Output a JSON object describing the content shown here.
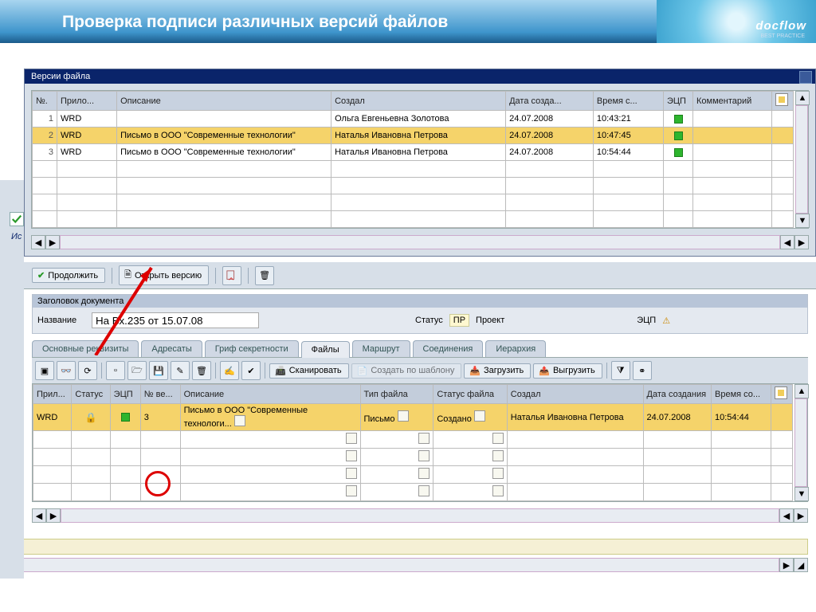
{
  "banner": {
    "title": "Проверка подписи различных версий файлов",
    "logo": "docflow",
    "logo_sub": "BEST PRACTICE"
  },
  "side": {
    "is": "Ис"
  },
  "versions": {
    "title": "Версии файла",
    "cols": [
      "№.",
      "Прило...",
      "Описание",
      "Создал",
      "Дата созда...",
      "Время с...",
      "ЭЦП",
      "Комментарий"
    ],
    "rows": [
      {
        "n": "1",
        "app": "WRD",
        "desc": "",
        "by": "Ольга Евгеньевна Золотова",
        "date": "24.07.2008",
        "time": "10:43:21",
        "ecp": true,
        "cmt": ""
      },
      {
        "n": "2",
        "app": "WRD",
        "desc": "Письмо в ООО \"Современные технологии\"",
        "by": "Наталья Ивановна Петрова",
        "date": "24.07.2008",
        "time": "10:47:45",
        "ecp": true,
        "cmt": ""
      },
      {
        "n": "3",
        "app": "WRD",
        "desc": "Письмо в ООО \"Современные технологии\"",
        "by": "Наталья Ивановна Петрова",
        "date": "24.07.2008",
        "time": "10:54:44",
        "ecp": true,
        "cmt": ""
      }
    ],
    "highlight": 1
  },
  "toolbar": {
    "cont": "Продолжить",
    "open": "Открыть версию"
  },
  "header": {
    "box": "Заголовок документа",
    "name_lbl": "Название",
    "name_val": "На Вх.235 от 15.07.08",
    "status_lbl": "Статус",
    "status_tag": "ПР",
    "status_val": "Проект",
    "ecp_lbl": "ЭЦП"
  },
  "tabs": [
    "Основные реквизиты",
    "Адресаты",
    "Гриф секретности",
    "Файлы",
    "Маршрут",
    "Соединения",
    "Иерархия"
  ],
  "tabs_active": 3,
  "file_toolbar": {
    "scan": "Сканировать",
    "tpl": "Создать по шаблону",
    "load": "Загрузить",
    "unload": "Выгрузить"
  },
  "files": {
    "cols": [
      "Прил...",
      "Статус",
      "ЭЦП",
      "№ ве...",
      "Описание",
      "Тип файла",
      "Статус файла",
      "Создал",
      "Дата создания",
      "Время со..."
    ],
    "row": {
      "app": "WRD",
      "stat": "lock",
      "ecp": true,
      "ver": "3",
      "desc": "Письмо в ООО \"Современные технологи...",
      "type": "Письмо",
      "fstat": "Создано",
      "by": "Наталья Ивановна Петрова",
      "date": "24.07.2008",
      "time": "10:54:44"
    }
  }
}
